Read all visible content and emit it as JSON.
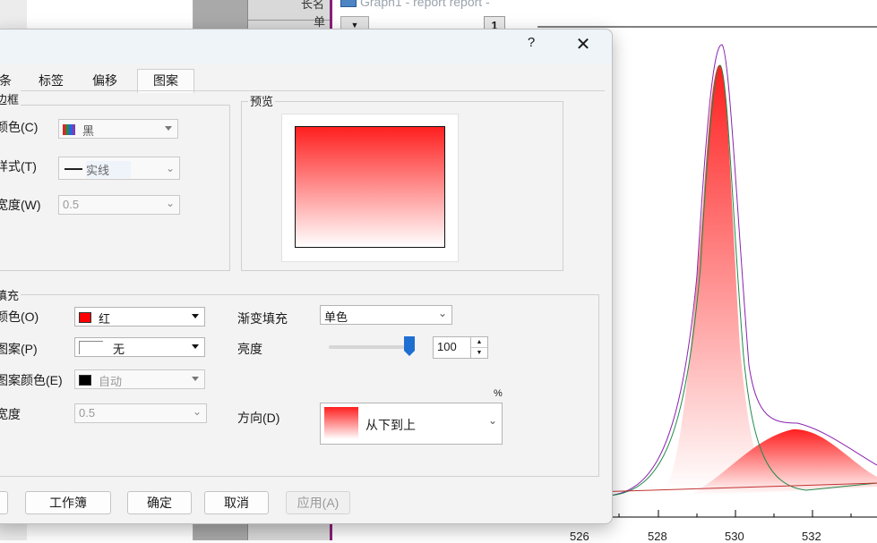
{
  "background_app": {
    "graph_window_title": "Graph1 - report report -",
    "column_header_long_name": "长名",
    "column_header_units": "单",
    "layer_tab": "1",
    "x_ticks": [
      "526",
      "528",
      "530",
      "532"
    ]
  },
  "dialog": {
    "help_label": "?",
    "close_label": "✕",
    "tabs": [
      {
        "label": "条"
      },
      {
        "label": "标签"
      },
      {
        "label": "偏移"
      },
      {
        "label": "图案",
        "selected": true
      }
    ],
    "border_group": {
      "title": "边框",
      "color_label": "颜色(C)",
      "color_value": "黑",
      "style_label": "样式(T)",
      "style_value": "实线",
      "width_label": "宽度(W)",
      "width_value": "0.5"
    },
    "preview_group": {
      "title": "预览",
      "gradient_top_color": "#ff1f1f",
      "gradient_bottom_color": "#ffffff"
    },
    "fill_group": {
      "title": "填充",
      "color_label": "颜色(O)",
      "color_value": "红",
      "color_swatch": "#ff0000",
      "pattern_label": "图案(P)",
      "pattern_value": "无",
      "pattern_color_label": "图案颜色(E)",
      "pattern_color_value": "自动",
      "pattern_color_swatch": "#000000",
      "width_label": "宽度",
      "width_value": "0.5",
      "gradient_fill_label": "渐变填充",
      "gradient_fill_value": "单色",
      "brightness_label": "亮度",
      "brightness_value": "100",
      "brightness_unit": "%",
      "direction_label": "方向(D)",
      "direction_value": "从下到上"
    },
    "buttons": {
      "workbook": "工作簿",
      "ok": "确定",
      "cancel": "取消",
      "apply": "应用(A)"
    }
  }
}
